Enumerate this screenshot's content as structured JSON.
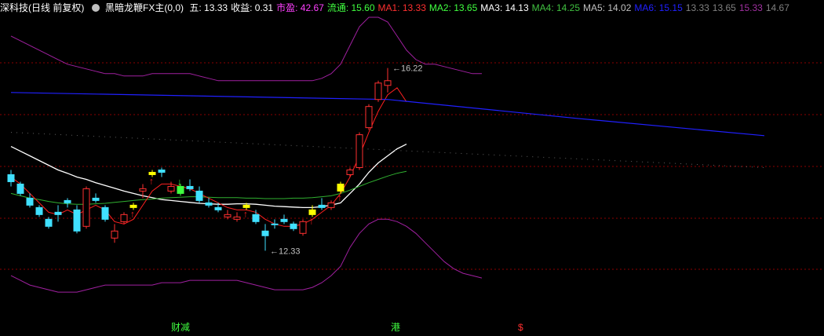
{
  "header": {
    "title": "深科技(日线 前复权)",
    "indicator": "黑暗龙鞭FX主(0,0)",
    "items": [
      {
        "label": "五",
        "value": "13.33",
        "color": "#ffffff"
      },
      {
        "label": "收益",
        "value": "0.31",
        "color": "#ffffff"
      },
      {
        "label": "市盈",
        "value": "42.67",
        "color": "#ff40ff"
      },
      {
        "label": "流通",
        "value": "15.60",
        "color": "#40ff40"
      },
      {
        "label": "MA1",
        "value": "13.33",
        "color": "#ff3030"
      },
      {
        "label": "MA2",
        "value": "13.65",
        "color": "#40ff40"
      },
      {
        "label": "MA3",
        "value": "14.13",
        "color": "#ffffff"
      },
      {
        "label": "MA4",
        "value": "14.25",
        "color": "#40c040"
      },
      {
        "label": "MA5",
        "value": "14.02",
        "color": "#c0c0c0"
      },
      {
        "label": "MA6",
        "value": "15.15",
        "color": "#2020ff"
      },
      {
        "label": "",
        "value": "13.33",
        "color": "#808080"
      },
      {
        "label": "",
        "value": "13.65",
        "color": "#808080"
      },
      {
        "label": "",
        "value": "15.33",
        "color": "#a030a0"
      },
      {
        "label": "",
        "value": "14.67",
        "color": "#808080"
      }
    ]
  },
  "bottom_labels": [
    {
      "text": "财减",
      "color": "#40ff40",
      "left": 218
    },
    {
      "text": "港",
      "color": "#40ff40",
      "left": 498
    },
    {
      "text": "$",
      "color": "#ff3030",
      "left": 660
    }
  ],
  "chart_data": {
    "type": "candlestick",
    "y_range": [
      10.9,
      17.3
    ],
    "annotations": [
      {
        "text": "16.22",
        "index": 40,
        "price": 16.22
      },
      {
        "text": "12.33",
        "index": 27,
        "price": 12.33
      }
    ],
    "candles": [
      [
        13.95,
        14.05,
        13.8,
        13.7,
        "cyan"
      ],
      [
        13.75,
        13.8,
        13.55,
        13.5,
        "cyan"
      ],
      [
        13.45,
        13.55,
        13.3,
        13.25,
        "cyan"
      ],
      [
        13.25,
        13.3,
        13.1,
        13.05,
        "cyan"
      ],
      [
        13.0,
        13.05,
        12.85,
        12.8,
        "cyan"
      ],
      [
        13.1,
        13.3,
        13.15,
        12.95,
        "cyan"
      ],
      [
        13.35,
        13.45,
        13.4,
        13.25,
        "cyan"
      ],
      [
        13.2,
        13.3,
        12.75,
        12.7,
        "cyan"
      ],
      [
        12.85,
        13.7,
        13.65,
        12.8,
        "red"
      ],
      [
        13.45,
        13.55,
        13.4,
        13.35,
        "cyan"
      ],
      [
        13.25,
        13.3,
        13.0,
        12.95,
        "cyan"
      ],
      [
        12.75,
        12.9,
        12.6,
        12.5,
        "red"
      ],
      [
        12.95,
        13.15,
        13.1,
        12.9,
        "red"
      ],
      [
        13.25,
        13.35,
        13.3,
        13.2,
        "yellow"
      ],
      [
        13.6,
        13.75,
        13.65,
        13.45,
        "red"
      ],
      [
        13.95,
        14.05,
        14.0,
        13.9,
        "yellow"
      ],
      [
        14.0,
        14.1,
        14.05,
        13.9,
        "cyan"
      ],
      [
        13.7,
        13.8,
        13.6,
        13.55,
        "red"
      ],
      [
        13.55,
        13.75,
        13.7,
        13.5,
        "green"
      ],
      [
        13.7,
        13.85,
        13.65,
        13.6,
        "cyan"
      ],
      [
        13.6,
        13.7,
        13.4,
        13.35,
        "cyan"
      ],
      [
        13.35,
        13.45,
        13.3,
        13.25,
        "cyan"
      ],
      [
        13.25,
        13.35,
        13.2,
        13.15,
        "cyan"
      ],
      [
        13.05,
        13.2,
        13.1,
        13.0,
        "red"
      ],
      [
        13.0,
        13.15,
        13.05,
        12.95,
        "red"
      ],
      [
        13.25,
        13.35,
        13.3,
        13.2,
        "yellow"
      ],
      [
        13.1,
        13.2,
        12.95,
        12.9,
        "cyan"
      ],
      [
        12.75,
        12.9,
        12.65,
        12.33,
        "cyan"
      ],
      [
        12.9,
        13.0,
        12.9,
        12.8,
        "cyan"
      ],
      [
        12.95,
        13.1,
        13.0,
        12.9,
        "cyan"
      ],
      [
        12.8,
        12.95,
        12.9,
        12.75,
        "cyan"
      ],
      [
        12.7,
        13.0,
        12.95,
        12.65,
        "red"
      ],
      [
        13.1,
        13.3,
        13.2,
        13.05,
        "yellow"
      ],
      [
        13.3,
        13.45,
        13.25,
        13.2,
        "cyan"
      ],
      [
        13.25,
        13.4,
        13.35,
        13.2,
        "red"
      ],
      [
        13.6,
        13.8,
        13.75,
        13.55,
        "yellow"
      ],
      [
        13.95,
        14.1,
        14.05,
        13.9,
        "red"
      ],
      [
        14.1,
        14.85,
        14.8,
        14.05,
        "red"
      ],
      [
        14.95,
        15.45,
        15.4,
        14.9,
        "red"
      ],
      [
        15.55,
        15.95,
        15.9,
        15.5,
        "red"
      ],
      [
        15.85,
        16.22,
        15.95,
        15.7,
        "red"
      ]
    ],
    "upper_band": [
      16.9,
      16.8,
      16.7,
      16.6,
      16.5,
      16.4,
      16.3,
      16.25,
      16.2,
      16.15,
      16.1,
      16.1,
      16.05,
      16.05,
      16.05,
      16.1,
      16.1,
      16.1,
      16.1,
      16.1,
      16.05,
      16.0,
      15.95,
      15.95,
      15.95,
      15.95,
      15.95,
      15.95,
      15.95,
      15.95,
      15.95,
      15.95,
      15.95,
      16.0,
      16.1,
      16.3,
      16.7,
      17.1,
      17.3,
      17.3,
      17.2,
      16.9,
      16.6,
      16.4,
      16.3,
      16.3,
      16.25,
      16.2,
      16.15,
      16.1,
      16.1
    ],
    "lower_band": [
      11.8,
      11.7,
      11.6,
      11.55,
      11.5,
      11.45,
      11.45,
      11.45,
      11.5,
      11.55,
      11.6,
      11.6,
      11.6,
      11.6,
      11.6,
      11.6,
      11.65,
      11.65,
      11.65,
      11.7,
      11.7,
      11.7,
      11.7,
      11.7,
      11.7,
      11.65,
      11.6,
      11.55,
      11.5,
      11.5,
      11.5,
      11.5,
      11.55,
      11.65,
      11.8,
      12.0,
      12.4,
      12.7,
      12.9,
      13.0,
      13.0,
      12.95,
      12.85,
      12.7,
      12.5,
      12.3,
      12.1,
      11.95,
      11.85,
      11.8,
      11.75
    ],
    "ma_white": [
      14.55,
      14.45,
      14.35,
      14.25,
      14.15,
      14.05,
      13.98,
      13.9,
      13.85,
      13.78,
      13.72,
      13.66,
      13.6,
      13.55,
      13.5,
      13.46,
      13.42,
      13.4,
      13.38,
      13.36,
      13.34,
      13.33,
      13.32,
      13.32,
      13.33,
      13.33,
      13.32,
      13.3,
      13.28,
      13.27,
      13.26,
      13.25,
      13.25,
      13.27,
      13.3,
      13.35,
      13.55,
      13.75,
      14.0,
      14.2,
      14.35,
      14.5,
      14.6
    ],
    "ma_green": [
      13.55,
      13.5,
      13.45,
      13.42,
      13.38,
      13.35,
      13.33,
      13.32,
      13.32,
      13.33,
      13.34,
      13.36,
      13.38,
      13.4,
      13.42,
      13.43,
      13.45,
      13.46,
      13.47,
      13.48,
      13.48,
      13.47,
      13.46,
      13.46,
      13.46,
      13.45,
      13.45,
      13.44,
      13.44,
      13.44,
      13.45,
      13.45,
      13.46,
      13.48,
      13.5,
      13.55,
      13.62,
      13.7,
      13.78,
      13.85,
      13.92,
      13.98,
      14.02
    ],
    "ma_red": [
      13.9,
      13.75,
      13.55,
      13.35,
      13.15,
      13.1,
      13.2,
      13.1,
      13.2,
      13.3,
      13.2,
      12.95,
      12.9,
      13.0,
      13.3,
      13.6,
      13.75,
      13.75,
      13.7,
      13.65,
      13.55,
      13.45,
      13.35,
      13.25,
      13.2,
      13.2,
      13.15,
      13.0,
      12.9,
      12.85,
      12.85,
      12.9,
      13.0,
      13.15,
      13.3,
      13.55,
      13.9,
      14.35,
      14.85,
      15.3,
      15.65,
      15.8,
      15.5
    ],
    "ma_blue": [
      [
        0,
        15.7
      ],
      [
        40,
        15.55
      ],
      [
        60,
        15.15
      ],
      [
        80,
        14.78
      ]
    ],
    "dots": [
      [
        0,
        14.85
      ],
      [
        80,
        14.1
      ]
    ]
  }
}
